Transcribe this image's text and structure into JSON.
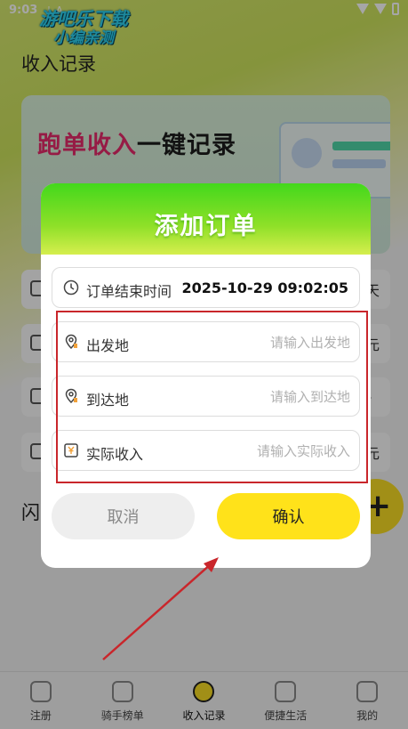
{
  "status_bar": {
    "time": "9:03",
    "small": "↓  A"
  },
  "watermark": {
    "line1": "游吧乐下载",
    "line2": "小编亲测"
  },
  "page_title": "收入记录",
  "banner": {
    "highlight": "跑单收入",
    "rest": "一键记录"
  },
  "background_rows": {
    "row1_end": "天",
    "row2_end": "元",
    "row3_end": "〉",
    "row4_end": "元"
  },
  "section_2_title": "闪",
  "fab_label": "+",
  "tabbar": {
    "tabs": [
      {
        "label": "注册"
      },
      {
        "label": "骑手榜单"
      },
      {
        "label": "收入记录"
      },
      {
        "label": "便捷生活"
      },
      {
        "label": "我的"
      }
    ]
  },
  "dialog": {
    "title": "添加订单",
    "end_time": {
      "label": "订单结束时间",
      "value": "2025-10-29 09:02:05"
    },
    "origin": {
      "label": "出发地",
      "placeholder": "请输入出发地"
    },
    "destination": {
      "label": "到达地",
      "placeholder": "请输入到达地"
    },
    "income": {
      "label": "实际收入",
      "placeholder": "请输入实际收入"
    },
    "cancel_label": "取消",
    "confirm_label": "确认"
  },
  "colors": {
    "accent": "#ffe21a",
    "header_green": "#43d81c",
    "annotation_red": "#c9262b"
  }
}
